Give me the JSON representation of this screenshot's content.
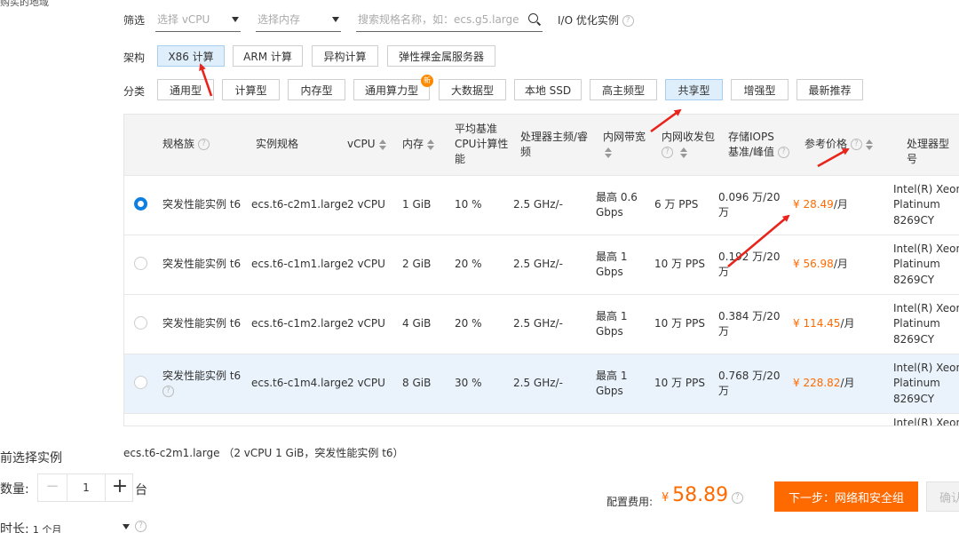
{
  "top_cut_text": "购买的地域",
  "filter": {
    "label": "筛选",
    "vcpu_placeholder": "选择 vCPU",
    "memory_placeholder": "选择内存",
    "search_placeholder": "搜索规格名称，如：ecs.g5.large",
    "io_label": "I/O 优化实例"
  },
  "arch": {
    "label": "架构",
    "options": [
      "X86 计算",
      "ARM 计算",
      "异构计算",
      "弹性裸金属服务器"
    ],
    "selected": "X86 计算"
  },
  "category": {
    "label": "分类",
    "options": [
      "通用型",
      "计算型",
      "内存型",
      "通用算力型",
      "大数据型",
      "本地 SSD",
      "高主频型",
      "共享型",
      "增强型",
      "最新推荐"
    ],
    "new_badge": "新",
    "selected": "共享型"
  },
  "table": {
    "headers": {
      "family": "规格族",
      "spec": "实例规格",
      "vcpu": "vCPU",
      "memory": "内存",
      "baseline_l1": "平均基准",
      "baseline_l2": "CPU计算性",
      "baseline_l3": "能",
      "freq_l1": "处理器主频/睿",
      "freq_l2": "频",
      "bandwidth": "内网带宽",
      "pps": "内网收发包",
      "iops_l1": "存储IOPS",
      "iops_l2": "基准/峰值",
      "price": "参考价格",
      "cpu_model": "处理器型号"
    },
    "rows": [
      {
        "family": "突发性能实例 t6",
        "spec": "ecs.t6-c2m1.large",
        "vcpu": "2 vCPU",
        "memory": "1 GiB",
        "baseline": "10 %",
        "freq": "2.5 GHz/-",
        "bw_l1": "最高 0.6",
        "bw_l2": "Gbps",
        "pps": "6 万 PPS",
        "iops_l1": "0.096 万/20",
        "iops_l2": "万",
        "price": "¥ 28.49",
        "price_unit": " /月",
        "cpu_l1": "Intel(R) Xeon(R)",
        "cpu_l2": "Platinum",
        "cpu_l3": "8269CY"
      },
      {
        "family": "突发性能实例 t6",
        "spec": "ecs.t6-c1m1.large",
        "vcpu": "2 vCPU",
        "memory": "2 GiB",
        "baseline": "20 %",
        "freq": "2.5 GHz/-",
        "bw_l1": "最高 1",
        "bw_l2": "Gbps",
        "pps": "10 万 PPS",
        "iops_l1": "0.192 万/20",
        "iops_l2": "万",
        "price": "¥ 56.98",
        "price_unit": " /月",
        "cpu_l1": "Intel(R) Xeon(R)",
        "cpu_l2": "Platinum",
        "cpu_l3": "8269CY"
      },
      {
        "family": "突发性能实例 t6",
        "spec": "ecs.t6-c1m2.large",
        "vcpu": "2 vCPU",
        "memory": "4 GiB",
        "baseline": "20 %",
        "freq": "2.5 GHz/-",
        "bw_l1": "最高 1",
        "bw_l2": "Gbps",
        "pps": "10 万 PPS",
        "iops_l1": "0.384 万/20",
        "iops_l2": "万",
        "price": "¥ 114.45",
        "price_unit": " /月",
        "cpu_l1": "Intel(R) Xeon(R)",
        "cpu_l2": "Platinum",
        "cpu_l3": "8269CY"
      },
      {
        "family": "突发性能实例 t6",
        "spec": "ecs.t6-c1m4.large",
        "vcpu": "2 vCPU",
        "memory": "8 GiB",
        "baseline": "30 %",
        "freq": "2.5 GHz/-",
        "bw_l1": "最高 1",
        "bw_l2": "Gbps",
        "pps": "10 万 PPS",
        "iops_l1": "0.768 万/20",
        "iops_l2": "万",
        "price": "¥ 228.82",
        "price_unit": " /月",
        "cpu_l1": "Intel(R) Xeon(R)",
        "cpu_l2": "Platinum",
        "cpu_l3": "8269CY"
      }
    ],
    "partial_row_cpu": "Intel(R) Xeon(R)"
  },
  "summary": {
    "section_title": "前选择实例",
    "selected_text": "ecs.t6-c2m1.large （2 vCPU 1 GiB，突发性能实例 t6）"
  },
  "quantity": {
    "label": "数量:",
    "value": "1",
    "unit": "台"
  },
  "duration": {
    "label": "时长:",
    "value": "1 个月"
  },
  "fee": {
    "label": "配置费用:",
    "symbol": "¥",
    "amount": "58.89"
  },
  "actions": {
    "next": "下一步：网络和安全组",
    "confirm": "确认"
  },
  "colors": {
    "accent_orange": "#ff6a00",
    "selected_blue": "#0d7fe0",
    "annotation_red": "#e8241c"
  }
}
